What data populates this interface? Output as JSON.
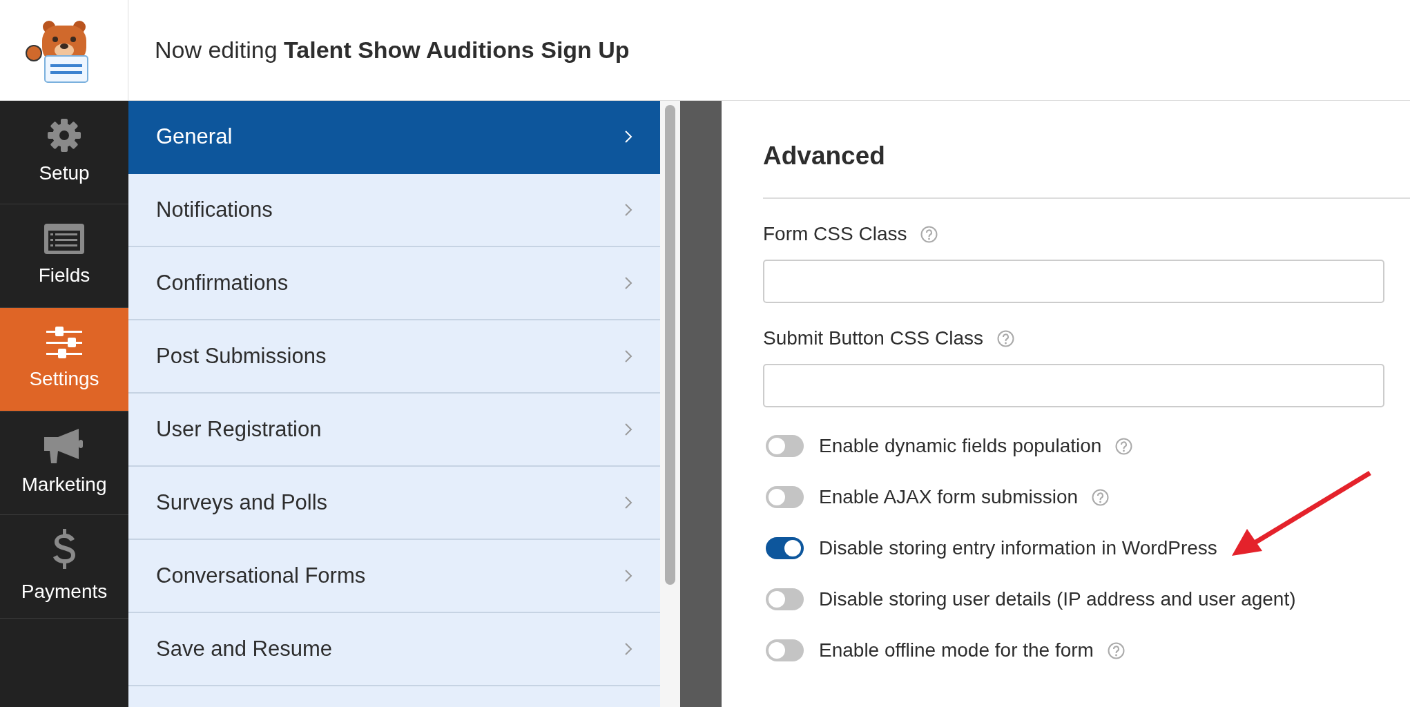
{
  "header": {
    "prefix": "Now editing",
    "form_name": "Talent Show Auditions Sign Up"
  },
  "sidebar": {
    "items": [
      {
        "kind": "setup",
        "label": "Setup",
        "selected": false
      },
      {
        "kind": "fields",
        "label": "Fields",
        "selected": false
      },
      {
        "kind": "settings",
        "label": "Settings",
        "selected": true
      },
      {
        "kind": "marketing",
        "label": "Marketing",
        "selected": false
      },
      {
        "kind": "payments",
        "label": "Payments",
        "selected": false
      }
    ]
  },
  "settings_nav": {
    "items": [
      {
        "label": "General",
        "selected": true
      },
      {
        "label": "Notifications",
        "selected": false
      },
      {
        "label": "Confirmations",
        "selected": false
      },
      {
        "label": "Post Submissions",
        "selected": false
      },
      {
        "label": "User Registration",
        "selected": false
      },
      {
        "label": "Surveys and Polls",
        "selected": false
      },
      {
        "label": "Conversational Forms",
        "selected": false
      },
      {
        "label": "Save and Resume",
        "selected": false
      }
    ]
  },
  "panel": {
    "title": "Advanced",
    "fields": [
      {
        "label": "Form CSS Class",
        "help": true
      },
      {
        "label": "Submit Button CSS Class",
        "help": true
      }
    ],
    "toggles": [
      {
        "label": "Enable dynamic fields population",
        "on": false,
        "help": true
      },
      {
        "label": "Enable AJAX form submission",
        "on": false,
        "help": true
      },
      {
        "label": "Disable storing entry information in WordPress",
        "on": true,
        "help": false
      },
      {
        "label": "Disable storing user details (IP address and user agent)",
        "on": false,
        "help": false
      },
      {
        "label": "Enable offline mode for the form",
        "on": false,
        "help": true
      }
    ]
  }
}
